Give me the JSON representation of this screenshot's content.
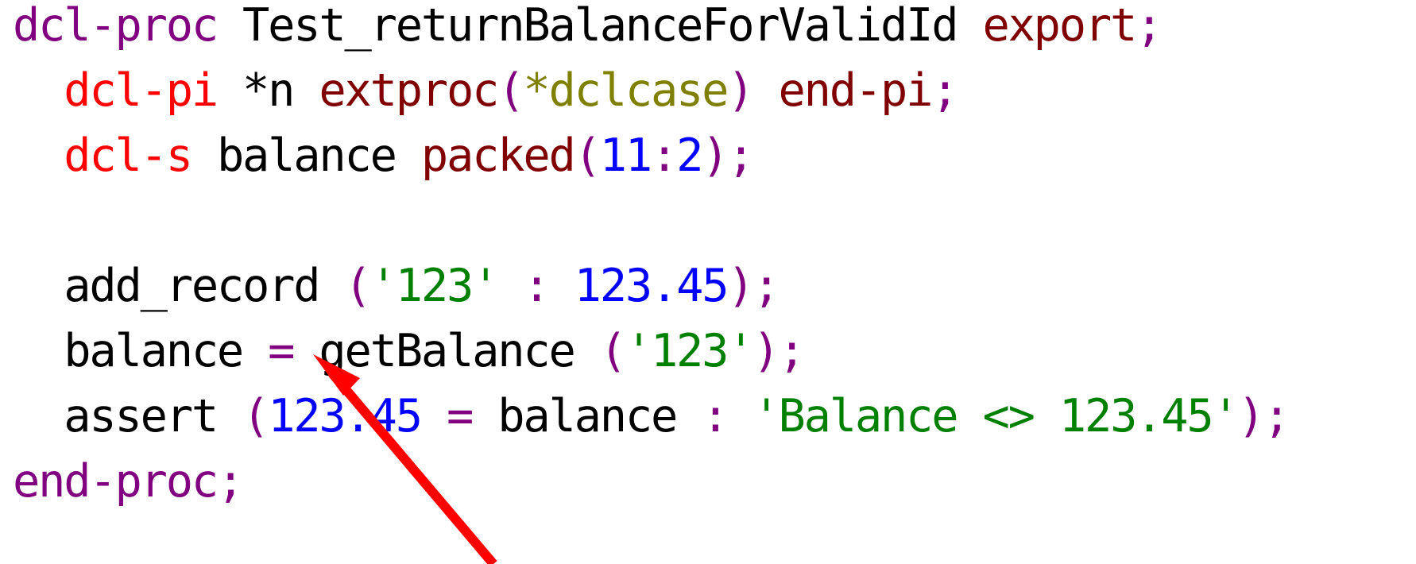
{
  "code": {
    "line1": {
      "kw": "dcl-proc",
      "name": " Test_returnBalanceForValidId ",
      "export": "export",
      "semi": ";"
    },
    "line2": {
      "indent": "  ",
      "kw": "dcl-pi",
      "star_n": " *n ",
      "extproc": "extproc",
      "open": "(",
      "dclcase": "*dclcase",
      "close": ")",
      "space": " ",
      "endpi": "end-pi",
      "semi": ";"
    },
    "line3": {
      "indent": "  ",
      "kw": "dcl-s",
      "name": " balance ",
      "packed": "packed",
      "open": "(",
      "digits": "11",
      "colon": ":",
      "decimals": "2",
      "close": ")",
      "semi": ";"
    },
    "line4": {
      "text": " "
    },
    "line5": {
      "indent": "  ",
      "call": "add_record ",
      "open": "(",
      "arg1": "'123'",
      "sep": " : ",
      "arg2": "123.45",
      "close": ")",
      "semi": ";"
    },
    "line6": {
      "indent": "  ",
      "var": "balance ",
      "eq": "=",
      "call": " getBalance ",
      "open": "(",
      "arg": "'123'",
      "close": ")",
      "semi": ";"
    },
    "line7": {
      "indent": "  ",
      "call": "assert ",
      "open": "(",
      "num": "123.45",
      "eq": " = ",
      "var": "balance",
      "sep": " : ",
      "msg": "'Balance <> 123.45'",
      "close": ")",
      "semi": ";"
    },
    "line8": {
      "kw": "end-proc",
      "semi": ";"
    }
  },
  "annotation": {
    "arrow_color": "#ff0000",
    "icon": "red-arrow-icon"
  },
  "colors": {
    "purple_keyword": "#800080",
    "red_keyword": "#ff0000",
    "dark_red_builtin": "#800000",
    "olive_special": "#808000",
    "blue_number": "#0000ff",
    "green_string": "#008000",
    "black_text": "#000000"
  }
}
